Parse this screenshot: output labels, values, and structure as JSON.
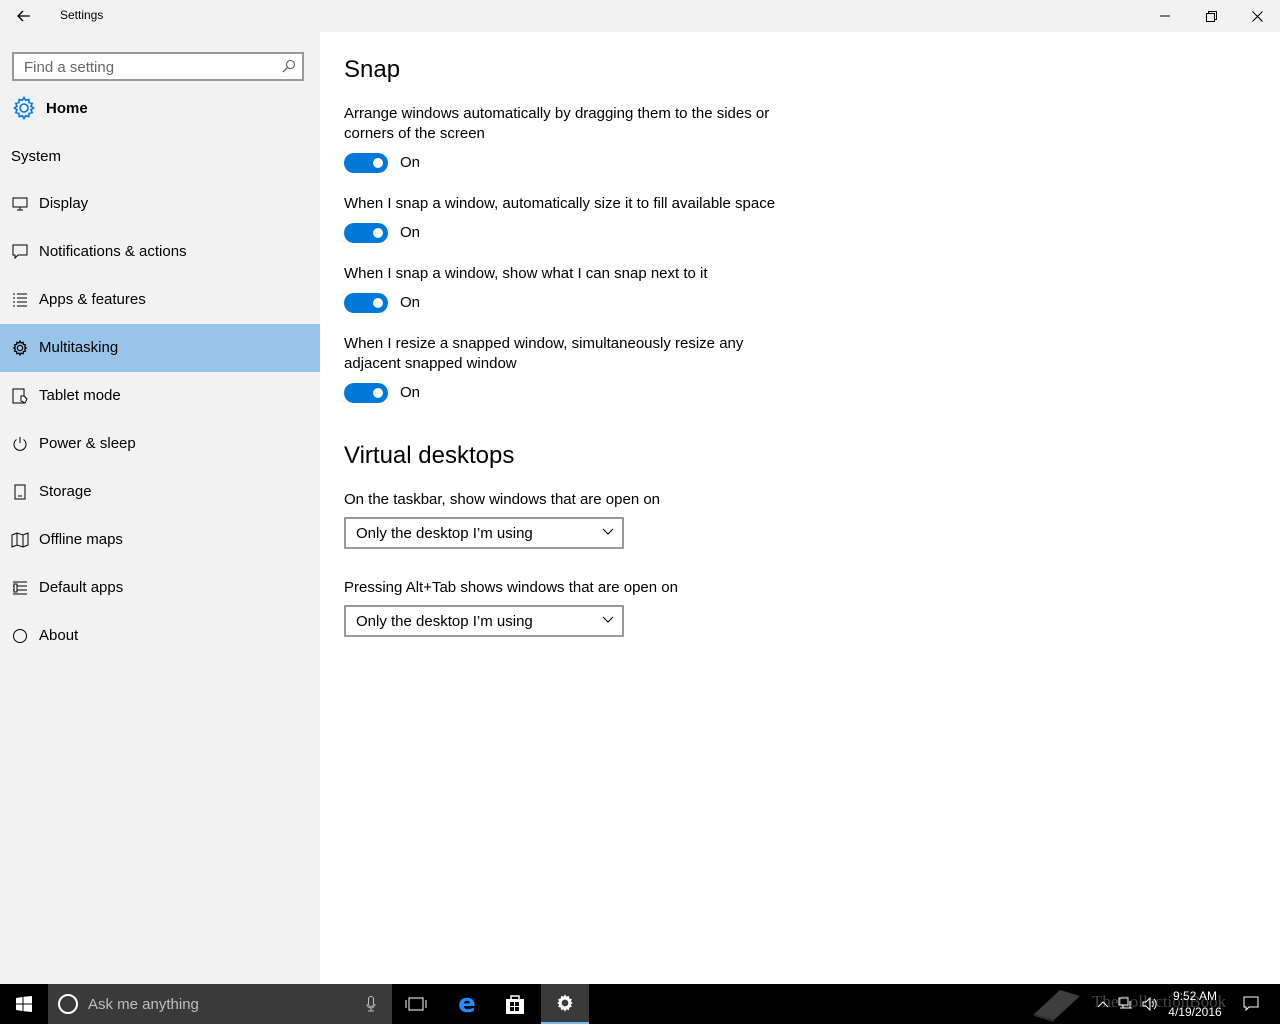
{
  "window": {
    "title": "Settings"
  },
  "sidebar": {
    "search_placeholder": "Find a setting",
    "home_label": "Home",
    "group_label": "System",
    "items": [
      {
        "label": "Display",
        "icon": "monitor-icon"
      },
      {
        "label": "Notifications & actions",
        "icon": "message-icon"
      },
      {
        "label": "Apps & features",
        "icon": "list-icon"
      },
      {
        "label": "Multitasking",
        "icon": "gear-icon",
        "selected": true
      },
      {
        "label": "Tablet mode",
        "icon": "tablet-mode-icon"
      },
      {
        "label": "Power & sleep",
        "icon": "power-icon"
      },
      {
        "label": "Storage",
        "icon": "storage-icon"
      },
      {
        "label": "Offline maps",
        "icon": "map-icon"
      },
      {
        "label": "Default apps",
        "icon": "default-apps-icon"
      },
      {
        "label": "About",
        "icon": "info-icon"
      }
    ]
  },
  "content": {
    "snap": {
      "heading": "Snap",
      "settings": [
        {
          "label": "Arrange windows automatically by dragging them to the sides or corners of the screen",
          "state": "On",
          "on": true
        },
        {
          "label": "When I snap a window, automatically size it to fill available space",
          "state": "On",
          "on": true
        },
        {
          "label": "When I snap a window, show what I can snap next to it",
          "state": "On",
          "on": true
        },
        {
          "label": "When I resize a snapped window, simultaneously resize any adjacent snapped window",
          "state": "On",
          "on": true
        }
      ]
    },
    "virtual_desktops": {
      "heading": "Virtual desktops",
      "settings": [
        {
          "label": "On the taskbar, show windows that are open on",
          "value": "Only the desktop I’m using"
        },
        {
          "label": "Pressing Alt+Tab shows windows that are open on",
          "value": "Only the desktop I’m using"
        }
      ]
    }
  },
  "taskbar": {
    "search_placeholder": "Ask me anything",
    "time": "9:52 AM",
    "date": "4/19/2016",
    "watermark": "TheCollectionBook",
    "accent_color": "#0078d7"
  }
}
